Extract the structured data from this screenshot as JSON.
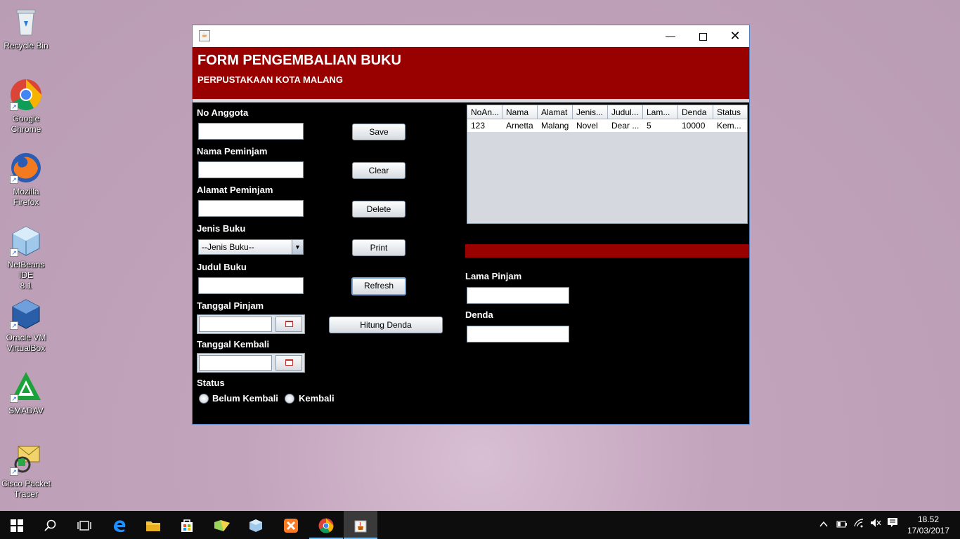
{
  "desktop": {
    "icons": [
      {
        "label_lines": [
          "Recycle Bin"
        ]
      },
      {
        "label_lines": [
          "Google",
          "Chrome"
        ]
      },
      {
        "label_lines": [
          "Mozilla",
          "Firefox"
        ]
      },
      {
        "label_lines": [
          "NetBeans IDE",
          "8.1"
        ]
      },
      {
        "label_lines": [
          "Oracle VM",
          "VirtualBox"
        ]
      },
      {
        "label_lines": [
          "SMADAV"
        ]
      },
      {
        "label_lines": [
          "Cisco Packet",
          "Tracer"
        ]
      }
    ]
  },
  "window": {
    "header_title": "FORM PENGEMBALIAN BUKU",
    "header_subtitle": "PERPUSTAKAAN KOTA MALANG"
  },
  "form": {
    "no_anggota_label": "No Anggota",
    "nama_peminjam_label": "Nama Peminjam",
    "alamat_peminjam_label": "Alamat Peminjam",
    "jenis_buku_label": "Jenis Buku",
    "jenis_buku_selected": "--Jenis Buku--",
    "judul_buku_label": "Judul Buku",
    "tanggal_pinjam_label": "Tanggal Pinjam",
    "tanggal_kembali_label": "Tanggal Kembali",
    "status_label": "Status",
    "status_options": [
      "Belum Kembali",
      "Kembali"
    ],
    "lama_pinjam_label": "Lama Pinjam",
    "denda_label": "Denda"
  },
  "buttons": {
    "save": "Save",
    "clear": "Clear",
    "delete": "Delete",
    "print": "Print",
    "refresh": "Refresh",
    "hitung_denda": "Hitung Denda"
  },
  "table": {
    "columns": [
      "NoAn...",
      "Nama",
      "Alamat",
      "Jenis...",
      "Judul...",
      "Lam...",
      "Denda",
      "Status"
    ],
    "rows": [
      [
        "123",
        "Arnetta",
        "Malang",
        "Novel",
        "Dear ...",
        "5",
        "10000",
        "Kem..."
      ]
    ]
  },
  "taskbar": {
    "time": "18.52",
    "date": "17/03/2017"
  }
}
